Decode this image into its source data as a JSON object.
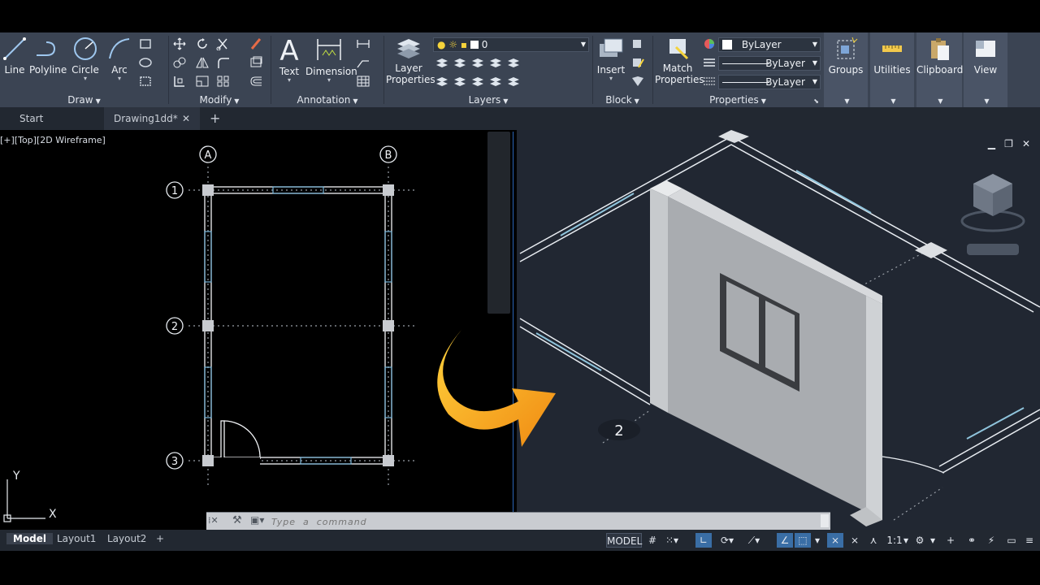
{
  "colors": {
    "ribbon_bg": "#3b4453",
    "accent": "#2b66b8",
    "arrow": "#f5a623",
    "viewport_bg": "#212732"
  },
  "ribbon": {
    "draw": {
      "title": "Draw",
      "tools": [
        "Line",
        "Polyline",
        "Circle",
        "Arc"
      ]
    },
    "modify": {
      "title": "Modify"
    },
    "annotation": {
      "title": "Annotation",
      "tools": [
        "Text",
        "Dimension"
      ]
    },
    "layers": {
      "title": "Layers",
      "tool": "Layer Properties",
      "tool_line1": "Layer",
      "tool_line2": "Properties",
      "layer_value": "0"
    },
    "block": {
      "title": "Block",
      "tool": "Insert"
    },
    "properties": {
      "title": "Properties",
      "tool_line1": "Match",
      "tool_line2": "Properties",
      "color_value": "ByLayer",
      "linetype_value": "ByLayer",
      "lineweight_value": "ByLayer"
    },
    "extra": [
      "Groups",
      "Utilities",
      "Clipboard",
      "View"
    ]
  },
  "tabs": {
    "start": "Start",
    "drawing": "Drawing1dd*",
    "close": "✕",
    "add": "+"
  },
  "viewport_left": {
    "label": "[+][Top][2D Wireframe]",
    "grid_cols": [
      "A",
      "B"
    ],
    "grid_rows": [
      "1",
      "2",
      "3"
    ],
    "ucs_x": "X",
    "ucs_y": "Y"
  },
  "viewport_right": {
    "grid_label": "2"
  },
  "command": {
    "placeholder": "Type  a  command"
  },
  "layout_tabs": [
    "Model",
    "Layout1",
    "Layout2",
    "+"
  ],
  "status": {
    "model": "MODEL",
    "scale": "1:1"
  },
  "icons": [
    "line-icon",
    "polyline-icon",
    "circle-icon",
    "arc-icon",
    "move-icon",
    "rotate-icon",
    "trim-icon",
    "text-icon",
    "dimension-icon",
    "layer-properties-icon",
    "insert-icon",
    "match-properties-icon",
    "groups-icon",
    "utilities-icon",
    "clipboard-icon",
    "view-icon",
    "curved-arrow-icon",
    "viewcube-icon",
    "ucs-icon",
    "gear-icon"
  ]
}
